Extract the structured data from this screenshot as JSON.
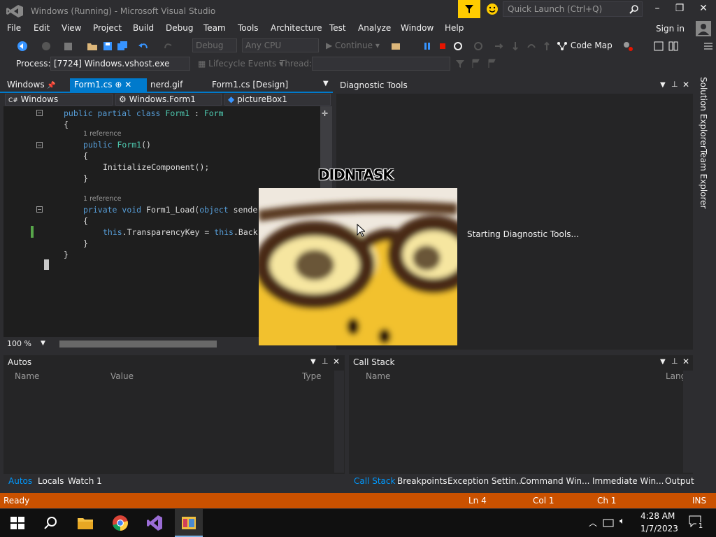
{
  "window": {
    "title": "Windows (Running) - Microsoft Visual Studio"
  },
  "quick_launch": {
    "placeholder": "Quick Launch (Ctrl+Q)"
  },
  "menu": [
    "File",
    "Edit",
    "View",
    "Project",
    "Build",
    "Debug",
    "Team",
    "Tools",
    "Architecture",
    "Test",
    "Analyze",
    "Window",
    "Help"
  ],
  "account": {
    "sign_in": "Sign in"
  },
  "toolbar": {
    "config": "Debug",
    "platform": "Any CPU",
    "continue": "Continue",
    "code_map": "Code Map"
  },
  "process_bar": {
    "label": "Process:",
    "process": "[7724] Windows.vshost.exe",
    "lifecycle": "Lifecycle Events",
    "thread_label": "Thread:"
  },
  "doc_tabs": [
    {
      "label": "Windows",
      "pinned": true
    },
    {
      "label": "Form1.cs",
      "active": true
    },
    {
      "label": "nerd.gif"
    },
    {
      "label": "Form1.cs [Design]"
    }
  ],
  "nav": {
    "project": "Windows",
    "type": "Windows.Form1",
    "member": "pictureBox1"
  },
  "code": {
    "lines": [
      {
        "tokens": [
          [
            "kw",
            "public "
          ],
          [
            "kw",
            "partial "
          ],
          [
            "kw",
            "class "
          ],
          [
            "ty",
            "Form1"
          ],
          [
            "pl",
            " : "
          ],
          [
            "ty",
            "Form"
          ]
        ]
      },
      {
        "tokens": [
          [
            "pl",
            "{"
          ]
        ]
      },
      {
        "ref": "1 reference"
      },
      {
        "tokens": [
          [
            "kw",
            "public "
          ],
          [
            "ty",
            "Form1"
          ],
          [
            "pl",
            "()"
          ]
        ]
      },
      {
        "tokens": [
          [
            "pl",
            "{"
          ]
        ]
      },
      {
        "tokens": [
          [
            "pl",
            "InitializeComponent();"
          ]
        ]
      },
      {
        "tokens": [
          [
            "pl",
            "}"
          ]
        ]
      },
      {
        "ref": "1 reference"
      },
      {
        "tokens": [
          [
            "kw",
            "private "
          ],
          [
            "kw",
            "void "
          ],
          [
            "pl",
            "Form1_Load("
          ],
          [
            "kw",
            "object "
          ],
          [
            "pl",
            "sende"
          ]
        ]
      },
      {
        "tokens": [
          [
            "pl",
            "{"
          ]
        ]
      },
      {
        "tokens": [
          [
            "kw",
            "this"
          ],
          [
            "pl",
            ".TransparencyKey = "
          ],
          [
            "kw",
            "this"
          ],
          [
            "pl",
            ".Back"
          ]
        ]
      },
      {
        "tokens": [
          [
            "pl",
            "}"
          ]
        ]
      },
      {
        "tokens": [
          [
            "pl",
            "}"
          ]
        ]
      }
    ]
  },
  "editor": {
    "zoom": "100 %"
  },
  "diagnostic": {
    "title": "Diagnostic Tools",
    "status": "Starting Diagnostic Tools..."
  },
  "side_tabs": [
    "Solution Explorer",
    "Team Explorer"
  ],
  "autos": {
    "title": "Autos",
    "columns": [
      "Name",
      "Value",
      "Type"
    ]
  },
  "call_stack": {
    "title": "Call Stack",
    "columns": [
      "Name",
      "Lang"
    ]
  },
  "left_bottom_tabs": [
    "Autos",
    "Locals",
    "Watch 1"
  ],
  "right_bottom_tabs": [
    "Call Stack",
    "Breakpoints",
    "Exception Settin...",
    "Command Win...",
    "Immediate Win...",
    "Output"
  ],
  "status": {
    "state": "Ready",
    "ln": "Ln 4",
    "col": "Col 1",
    "ch": "Ch 1",
    "mode": "INS"
  },
  "overlay": {
    "caption": "DIDNTASK"
  },
  "clock": {
    "time": "4:28 AM",
    "date": "1/7/2023"
  },
  "notifications": {
    "count": "1"
  },
  "colors": {
    "accent": "#007acc",
    "status": "#ca5100",
    "notify": "#ffcc00"
  }
}
